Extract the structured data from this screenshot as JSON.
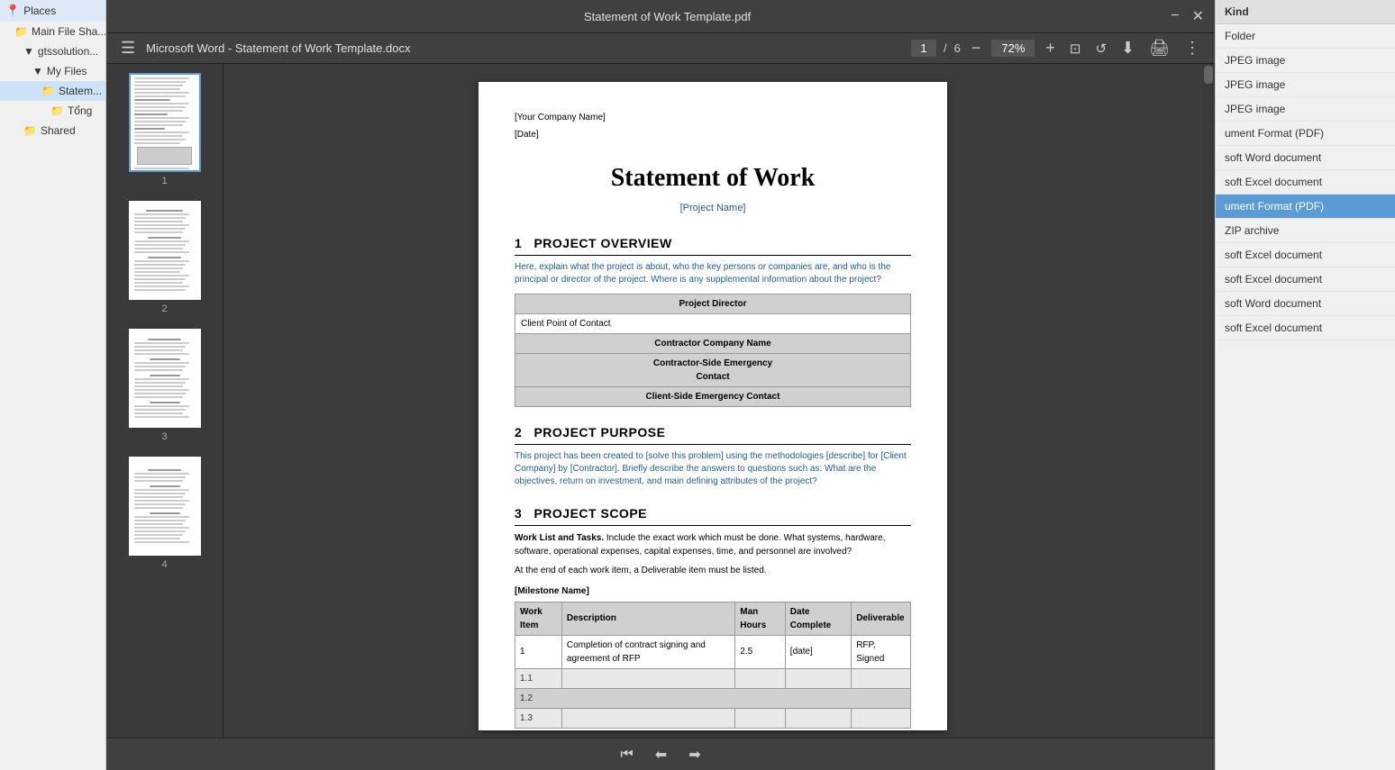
{
  "window": {
    "title": "Statement of Work Template.pdf",
    "minimize": "−",
    "close": "✕"
  },
  "toolbar": {
    "hamburger": "☰",
    "doc_title": "Microsoft Word - Statement of Work Template.docx",
    "page_current": "1",
    "page_separator": "/",
    "page_total": "6",
    "zoom_out": "−",
    "zoom_level": "72%",
    "zoom_in": "+",
    "fit_page": "⊡",
    "rotate": "↺",
    "download": "⬇",
    "print": "🖨",
    "more": "⋮"
  },
  "sidebar": {
    "items": [
      {
        "label": "Places",
        "indent": 0,
        "icon": "📍",
        "expanded": false
      },
      {
        "label": "Main File Sha...",
        "indent": 1,
        "icon": "📁",
        "expanded": false
      },
      {
        "label": "gtssolution...",
        "indent": 2,
        "icon": "▼",
        "expanded": true
      },
      {
        "label": "My Files",
        "indent": 3,
        "icon": "▼",
        "expanded": true
      },
      {
        "label": "Statem...",
        "indent": 4,
        "icon": "📁",
        "selected": true
      },
      {
        "label": "Tổng",
        "indent": 5,
        "icon": "📁"
      },
      {
        "label": "Shared",
        "indent": 2,
        "icon": "📁"
      }
    ]
  },
  "pdf": {
    "page1": {
      "company": "[Your Company Name]",
      "date": "[Date]",
      "title": "Statement of Work",
      "project_name": "[Project Name]",
      "section1_num": "1",
      "section1_title": "Project Overview",
      "section1_desc": "Here, explain what the project is about, who the key persons or companies are, and who is the principal or director of the project. Where is any supplemental information about the project?",
      "table_rows": [
        "Project Director",
        "Client Point of Contact",
        "Contractor Company Name",
        "Contractor-Side Emergency Contact",
        "Client-Side Emergency Contact"
      ],
      "section2_num": "2",
      "section2_title": "Project Purpose",
      "section2_desc": "This project has been created to [solve this problem] using the methodologies [describe] for [Client Company] by [Contractor]. Briefly describe the answers to questions such as: What are the objectives, return on investment, and main defining attributes of the project?",
      "section3_num": "3",
      "section3_title": "Project Scope",
      "section3_body1_bold": "Work List and Tasks.",
      "section3_body1": " Include the exact work which must be done. What systems, hardware, software, operational expenses, capital expenses, time, and personnel are involved?",
      "section3_body2": "At the end of each work item, a Deliverable item must be listed.",
      "milestone_label": "[Milestone Name]",
      "work_table_headers": [
        "Work Item",
        "Description",
        "Man Hours",
        "Date Complete",
        "Deliverable"
      ],
      "work_table_row1": [
        "1",
        "Completion of contract signing and agreement of RFP",
        "2.5",
        "[date]",
        "RFP, Signed"
      ],
      "row_1_1": "1.1",
      "row_1_2": "1.2",
      "row_1_3": "1.3"
    }
  },
  "thumbnails": [
    {
      "num": "1",
      "active": true
    },
    {
      "num": "2",
      "active": false
    },
    {
      "num": "3",
      "active": false
    },
    {
      "num": "4",
      "active": false
    }
  ],
  "right_panel": {
    "header": "Kind",
    "items": [
      {
        "label": "Folder",
        "selected": false
      },
      {
        "label": "JPEG image",
        "selected": false
      },
      {
        "label": "JPEG image",
        "selected": false
      },
      {
        "label": "JPEG image",
        "selected": false
      },
      {
        "label": "ument Format (PDF)",
        "selected": false
      },
      {
        "label": "soft Word document",
        "selected": false
      },
      {
        "label": "soft Excel document",
        "selected": false
      },
      {
        "label": "ument Format (PDF)",
        "selected": true
      },
      {
        "label": "ZIP archive",
        "selected": false
      },
      {
        "label": "soft Excel document",
        "selected": false
      },
      {
        "label": "soft Excel document",
        "selected": false
      },
      {
        "label": "soft Word document",
        "selected": false
      },
      {
        "label": "soft Excel document",
        "selected": false
      }
    ]
  }
}
